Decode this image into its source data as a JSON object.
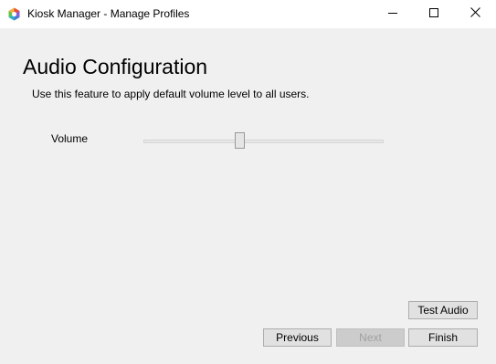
{
  "window": {
    "title": "Kiosk Manager - Manage Profiles",
    "icon": "kiosk-app-icon"
  },
  "titlebar_controls": {
    "minimize_icon": "minimize-icon",
    "maximize_icon": "maximize-icon",
    "close_icon": "close-icon"
  },
  "page": {
    "heading": "Audio Configuration",
    "description": "Use this feature to apply default volume level to all users."
  },
  "volume": {
    "label": "Volume",
    "level_fraction": 0.4
  },
  "buttons": {
    "test_audio": "Test Audio",
    "previous": "Previous",
    "next": "Next",
    "finish": "Finish"
  },
  "colors": {
    "window_bg": "#f0f0f0",
    "titlebar_bg": "#ffffff",
    "button_bg": "#e1e1e1",
    "button_border": "#adadad",
    "disabled_text": "#a0a0a0"
  }
}
